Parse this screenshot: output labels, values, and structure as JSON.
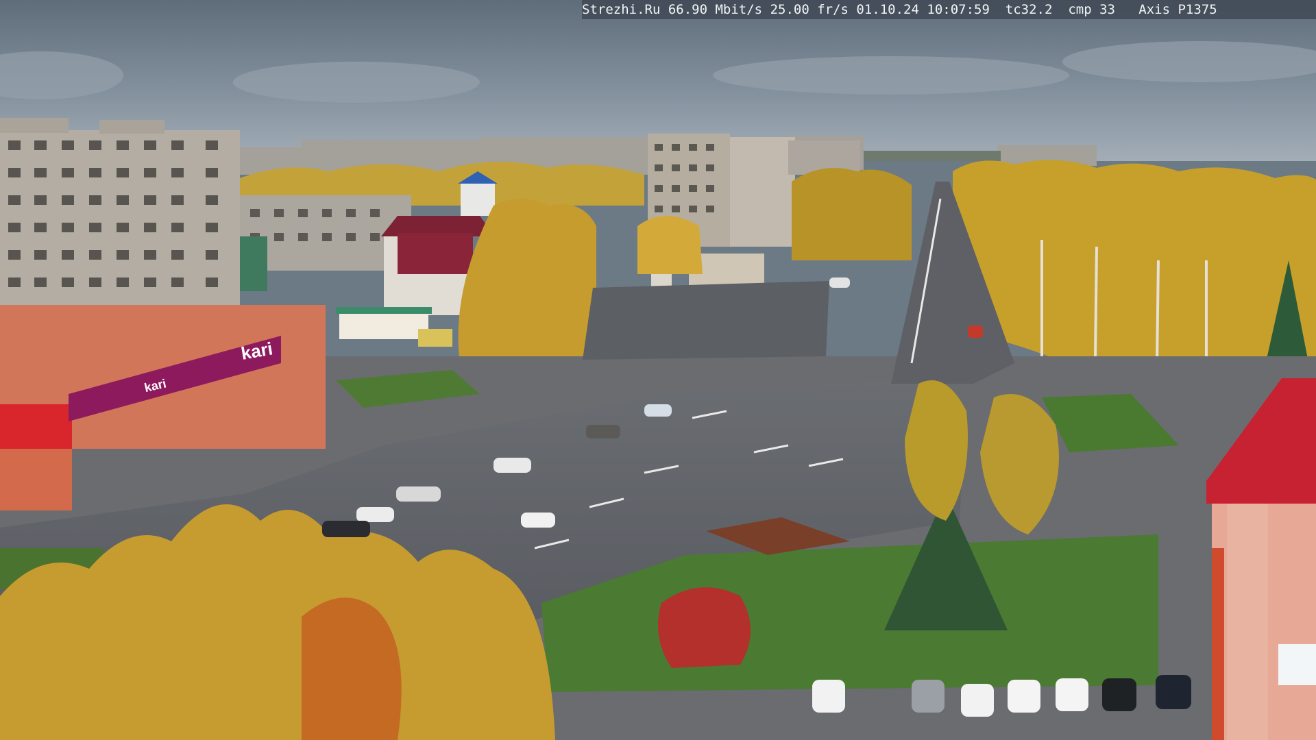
{
  "osd": {
    "site": "Strezhi.Ru",
    "bitrate": "66.90 Mbit/s",
    "framerate": "25.00 fr/s",
    "date": "01.10.24",
    "time": "10:07:59",
    "tc": "tc32.2",
    "cmp": "cmp 33",
    "camera": "Axis P1375"
  },
  "signs": {
    "store_logo": "kari",
    "store_logo_banner": "kari"
  },
  "colors": {
    "sky": "#7e8c99",
    "foliage": "#c9a233",
    "road": "#5e6167",
    "grass": "#4f7b35",
    "store_banner": "#8e1a5e",
    "roof_red": "#c72232"
  }
}
